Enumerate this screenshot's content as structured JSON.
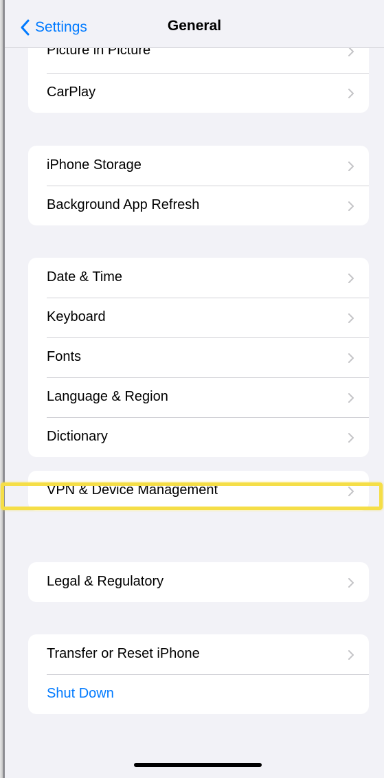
{
  "navbar": {
    "back_label": "Settings",
    "title": "General"
  },
  "groups": [
    {
      "rows": [
        {
          "label": "Picture in Picture"
        },
        {
          "label": "CarPlay"
        }
      ]
    },
    {
      "rows": [
        {
          "label": "iPhone Storage"
        },
        {
          "label": "Background App Refresh"
        }
      ]
    },
    {
      "rows": [
        {
          "label": "Date & Time"
        },
        {
          "label": "Keyboard"
        },
        {
          "label": "Fonts"
        },
        {
          "label": "Language & Region"
        },
        {
          "label": "Dictionary"
        }
      ]
    },
    {
      "rows": [
        {
          "label": "VPN & Device Management",
          "highlighted": true
        }
      ]
    },
    {
      "rows": [
        {
          "label": "Legal & Regulatory"
        }
      ]
    },
    {
      "rows": [
        {
          "label": "Transfer or Reset iPhone"
        },
        {
          "label": "Shut Down",
          "style": "link"
        }
      ]
    }
  ],
  "colors": {
    "accent": "#007aff",
    "background": "#f2f2f7",
    "highlight": "#f5de47"
  },
  "icons": {
    "back": "chevron-left-icon",
    "disclosure": "chevron-right-icon"
  }
}
